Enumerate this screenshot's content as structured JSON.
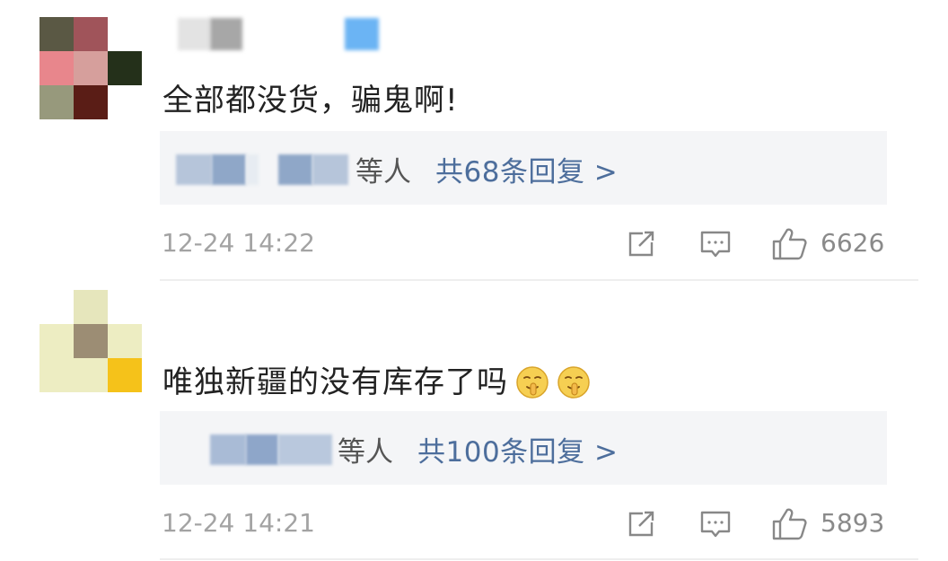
{
  "comments": [
    {
      "text": "全部都没货，骗鬼啊!",
      "reply_others": "等人",
      "reply_total": "共68条回复 >",
      "time": "12-24 14:22",
      "likes": "6626",
      "has_emoji": false
    },
    {
      "text": "唯独新疆的没有库存了吗",
      "emoji_names": [
        "shush-face-emoji",
        "shush-face-emoji"
      ],
      "reply_others": "等人",
      "reply_total": "共100条回复 >",
      "time": "12-24 14:21",
      "likes": "5893",
      "has_emoji": true
    }
  ],
  "icons": {
    "share": "share-icon",
    "comment": "comment-icon",
    "like": "thumbs-up-icon"
  },
  "colors": {
    "link_blue": "#4d6e9c",
    "meta_gray": "#a3a3a3",
    "reply_bg": "#f4f5f7"
  }
}
